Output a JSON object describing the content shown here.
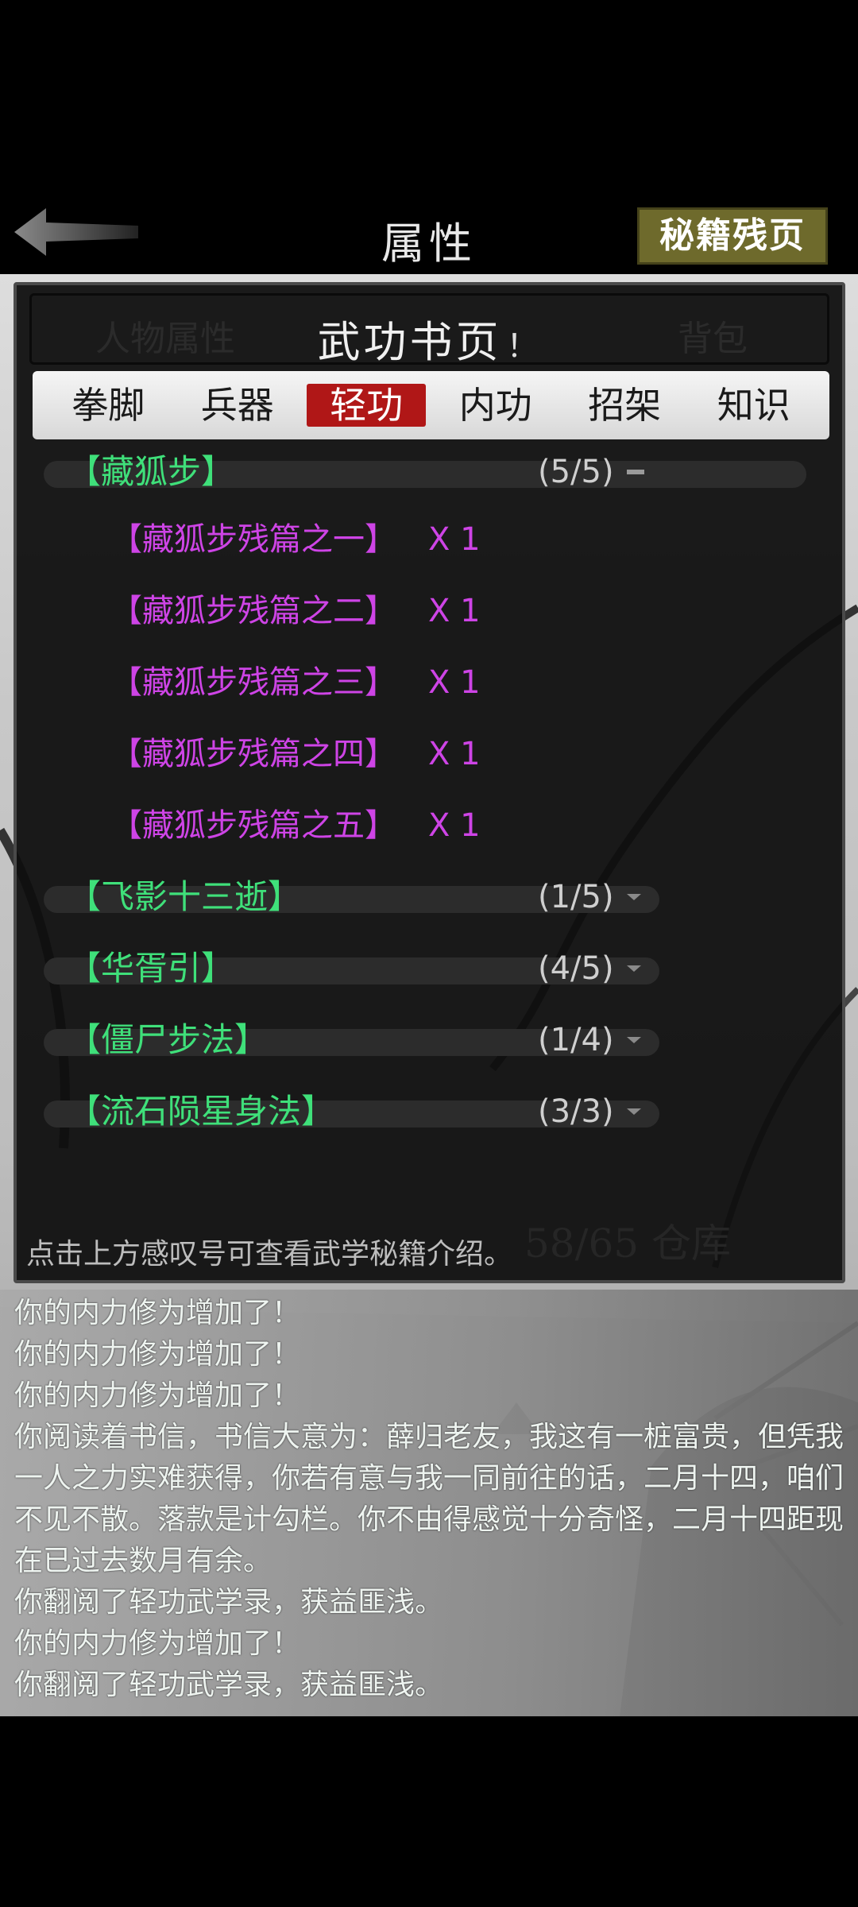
{
  "header": {
    "title": "属性",
    "right_button": "秘籍残页"
  },
  "dialog": {
    "title": "武功书页",
    "info_mark": "！",
    "ghost_left": "人物属性",
    "ghost_right": "背包",
    "tabs": [
      {
        "label": "拳脚",
        "active": false
      },
      {
        "label": "兵器",
        "active": false
      },
      {
        "label": "轻功",
        "active": true
      },
      {
        "label": "内功",
        "active": false
      },
      {
        "label": "招架",
        "active": false
      },
      {
        "label": "知识",
        "active": false
      }
    ],
    "categories": [
      {
        "name": "【藏狐步】",
        "count": "(5/5)",
        "expanded": true,
        "items": [
          {
            "name": "【藏狐步残篇之一】",
            "qty": "X 1"
          },
          {
            "name": "【藏狐步残篇之二】",
            "qty": "X 1"
          },
          {
            "name": "【藏狐步残篇之三】",
            "qty": "X 1"
          },
          {
            "name": "【藏狐步残篇之四】",
            "qty": "X 1"
          },
          {
            "name": "【藏狐步残篇之五】",
            "qty": "X 1"
          }
        ]
      },
      {
        "name": "【飞影十三逝】",
        "count": "(1/5)",
        "expanded": false
      },
      {
        "name": "【华胥引】",
        "count": "(4/5)",
        "expanded": false
      },
      {
        "name": "【僵尸步法】",
        "count": "(1/4)",
        "expanded": false
      },
      {
        "name": "【流石陨星身法】",
        "count": "(3/3)",
        "expanded": false
      }
    ],
    "hint": "点击上方感叹号可查看武学秘籍介绍。",
    "ghost_storage": "58/65 仓库"
  },
  "log": [
    "你的内力修为增加了！",
    "你的内力修为增加了！",
    "你的内力修为增加了！",
    "你阅读着书信，书信大意为：薛归老友，我这有一桩富贵，但凭我一人之力实难获得，你若有意与我一同前往的话，二月十四，咱们不见不散。落款是计勾栏。你不由得感觉十分奇怪，二月十四距现在已过去数月有余。",
    "你翻阅了轻功武学录，获益匪浅。",
    "你的内力修为增加了！",
    "你翻阅了轻功武学录，获益匪浅。"
  ],
  "colors": {
    "category": "#3fe07a",
    "fragment": "#ce44e6",
    "active_tab": "#b01717"
  }
}
